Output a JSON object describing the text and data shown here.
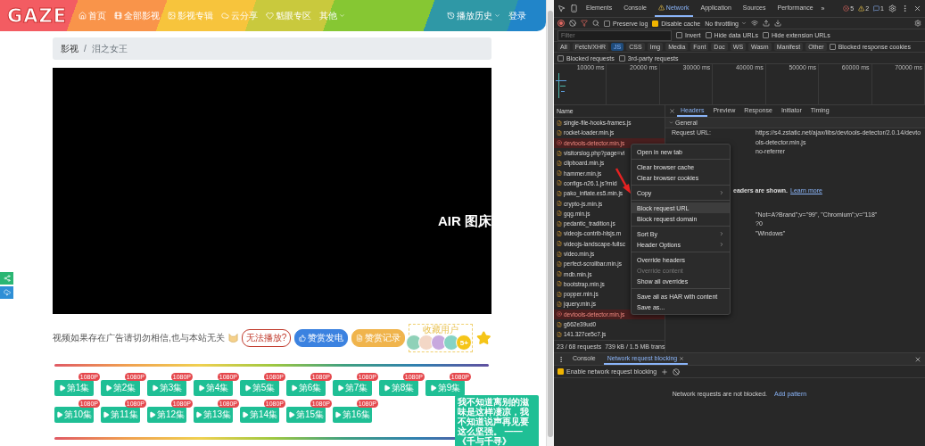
{
  "nav": {
    "logo": "GAZE",
    "items": [
      {
        "label": "首页",
        "dropdown": false
      },
      {
        "label": "全部影视",
        "dropdown": false
      },
      {
        "label": "影视专辑",
        "dropdown": false
      },
      {
        "label": "云分享",
        "dropdown": false
      },
      {
        "label": "魁眼专区",
        "dropdown": false
      },
      {
        "label": "其他",
        "dropdown": true
      }
    ],
    "history": {
      "label": "播放历史",
      "dropdown": true
    },
    "login": "登录"
  },
  "breadcrumb": {
    "items": [
      "影视",
      "泪之女王"
    ],
    "separator": "/"
  },
  "video": {
    "overlay_text": "AIR 图床"
  },
  "notice": "视频如果存在广告请切勿相信,也与本站无关",
  "actions": [
    {
      "label": "无法播放?",
      "kind": "outline"
    },
    {
      "label": "赞赏发电",
      "kind": "blue"
    },
    {
      "label": "赞赏记录",
      "kind": "yellow"
    }
  ],
  "collectors": {
    "title": "收藏用户",
    "avatars": [
      {
        "color": "#8fd1b8"
      },
      {
        "color": "#f3d7c6"
      },
      {
        "color": "#c8a8de"
      },
      {
        "color": "#86d3c4"
      }
    ],
    "more": "5+"
  },
  "episodes": [
    {
      "label": "第1集",
      "badge": "1080P"
    },
    {
      "label": "第2集",
      "badge": "1080P"
    },
    {
      "label": "第3集",
      "badge": "1080P"
    },
    {
      "label": "第4集",
      "badge": "1080P"
    },
    {
      "label": "第5集",
      "badge": "1080P"
    },
    {
      "label": "第6集",
      "badge": "1080P"
    },
    {
      "label": "第7集",
      "badge": "1080P"
    },
    {
      "label": "第8集",
      "badge": "1080P"
    },
    {
      "label": "第9集",
      "badge": "1080P"
    },
    {
      "label": "第10集",
      "badge": "1080P"
    },
    {
      "label": "第11集",
      "badge": "1080P"
    },
    {
      "label": "第12集",
      "badge": "1080P"
    },
    {
      "label": "第13集",
      "badge": "1080P"
    },
    {
      "label": "第14集",
      "badge": "1080P"
    },
    {
      "label": "第15集",
      "badge": "1080P"
    },
    {
      "label": "第16集",
      "badge": "1080P"
    }
  ],
  "quote": "我不知道离别的滋味是这样凄凉，我不知道说声再见要这么坚强。 ——《千与千寻》",
  "devtools": {
    "tabs": [
      {
        "label": "Elements",
        "selected": false,
        "warning": false
      },
      {
        "label": "Console",
        "selected": false,
        "warning": false
      },
      {
        "label": "Network",
        "selected": true,
        "warning": true
      },
      {
        "label": "Application",
        "selected": false,
        "warning": false
      },
      {
        "label": "Sources",
        "selected": false,
        "warning": false
      },
      {
        "label": "Performance",
        "selected": false,
        "warning": false
      }
    ],
    "more": "»",
    "errors": "5",
    "warnings": "2",
    "infos": "1",
    "preserve_log": {
      "label": "Preserve log",
      "checked": false
    },
    "disable_cache": {
      "label": "Disable cache",
      "checked": true
    },
    "throttling": "No throttling",
    "filter": {
      "placeholder": "Filter"
    },
    "filter_options": [
      {
        "label": "Invert",
        "checked": false
      },
      {
        "label": "Hide data URLs",
        "checked": false
      },
      {
        "label": "Hide extension URLs",
        "checked": false
      }
    ],
    "types": [
      {
        "label": "All",
        "selected": false
      },
      {
        "label": "Fetch/XHR",
        "selected": false
      },
      {
        "label": "JS",
        "selected": true
      },
      {
        "label": "CSS",
        "selected": false
      },
      {
        "label": "Img",
        "selected": false
      },
      {
        "label": "Media",
        "selected": false
      },
      {
        "label": "Font",
        "selected": false
      },
      {
        "label": "Doc",
        "selected": false
      },
      {
        "label": "WS",
        "selected": false
      },
      {
        "label": "Wasm",
        "selected": false
      },
      {
        "label": "Manifest",
        "selected": false
      },
      {
        "label": "Other",
        "selected": false
      }
    ],
    "blocked_cookies": {
      "label": "Blocked response cookies",
      "checked": false
    },
    "more_options": [
      {
        "label": "Blocked requests",
        "checked": false
      },
      {
        "label": "3rd-party requests",
        "checked": false
      }
    ],
    "ticks": [
      "10000 ms",
      "20000 ms",
      "30000 ms",
      "40000 ms",
      "50000 ms",
      "60000 ms",
      "70000 ms"
    ],
    "name_header": "Name",
    "requests": [
      {
        "name": "single-file-hooks-frames.js",
        "error": false
      },
      {
        "name": "rocket-loader.min.js",
        "error": false
      },
      {
        "name": "devtools-detector.min.js",
        "error": true
      },
      {
        "name": "visitorslog.php?page=vi",
        "error": false
      },
      {
        "name": "clipboard.min.js",
        "error": false
      },
      {
        "name": "hammer.min.js",
        "error": false
      },
      {
        "name": "configs-n26.1.js?mid",
        "error": false
      },
      {
        "name": "pako_inflate.es5.min.js",
        "error": false
      },
      {
        "name": "crypto-js.min.js",
        "error": false
      },
      {
        "name": "gqg.min.js",
        "error": false
      },
      {
        "name": "pedantic_tradition.js",
        "error": false
      },
      {
        "name": "videojs-contrib-hlsjs.m",
        "error": false
      },
      {
        "name": "videojs-landscape-fullsc",
        "error": false
      },
      {
        "name": "video.min.js",
        "error": false
      },
      {
        "name": "perfect-scrollbar.min.js",
        "error": false
      },
      {
        "name": "mdb.min.js",
        "error": false
      },
      {
        "name": "bootstrap.min.js",
        "error": false
      },
      {
        "name": "popper.min.js",
        "error": false
      },
      {
        "name": "jquery.min.js",
        "error": false
      },
      {
        "name": "devtools-detector.min.js",
        "error": true
      },
      {
        "name": "g662e39ud0",
        "error": false
      },
      {
        "name": "141.327ce5c7.js",
        "error": false
      }
    ],
    "status": {
      "requests": "23 / 68 requests",
      "transferred": "739 kB / 1.5 MB trans"
    },
    "detail_tabs": [
      {
        "label": "Headers",
        "selected": true
      },
      {
        "label": "Preview",
        "selected": false
      },
      {
        "label": "Response",
        "selected": false
      },
      {
        "label": "Initiator",
        "selected": false
      },
      {
        "label": "Timing",
        "selected": false
      }
    ],
    "general": {
      "title": "General",
      "request_url_label": "Request URL:",
      "request_url": "https://s4.zstatic.net/ajax/libs/devtools-detector/2.0.14/devtools-detector.min.js",
      "policy": "no-referrer"
    },
    "headers_note": "eaders are shown.",
    "learn_more": "Learn more",
    "header_values": [
      "\"Not=A?Brand\";v=\"99\", \"Chromium\";v=\"118\"",
      "?0",
      "\"Windows\""
    ],
    "context_menu": [
      [
        {
          "label": "Open in new tab",
          "submenu": false,
          "disabled": false,
          "selected": false
        }
      ],
      [
        {
          "label": "Clear browser cache",
          "submenu": false,
          "disabled": false,
          "selected": false
        },
        {
          "label": "Clear browser cookies",
          "submenu": false,
          "disabled": false,
          "selected": false
        }
      ],
      [
        {
          "label": "Copy",
          "submenu": true,
          "disabled": false,
          "selected": false
        }
      ],
      [
        {
          "label": "Block request URL",
          "submenu": false,
          "disabled": false,
          "selected": true
        },
        {
          "label": "Block request domain",
          "submenu": false,
          "disabled": false,
          "selected": false
        }
      ],
      [
        {
          "label": "Sort By",
          "submenu": true,
          "disabled": false,
          "selected": false
        },
        {
          "label": "Header Options",
          "submenu": true,
          "disabled": false,
          "selected": false
        }
      ],
      [
        {
          "label": "Override headers",
          "submenu": false,
          "disabled": false,
          "selected": false
        },
        {
          "label": "Override content",
          "submenu": false,
          "disabled": true,
          "selected": false
        },
        {
          "label": "Show all overrides",
          "submenu": false,
          "disabled": false,
          "selected": false
        }
      ],
      [
        {
          "label": "Save all as HAR with content",
          "submenu": false,
          "disabled": false,
          "selected": false
        },
        {
          "label": "Save as...",
          "submenu": false,
          "disabled": false,
          "selected": false
        }
      ]
    ],
    "drawer": {
      "tabs": [
        {
          "label": "Console",
          "selected": false
        },
        {
          "label": "Network request blocking",
          "selected": true
        }
      ],
      "enable": {
        "label": "Enable network request blocking",
        "checked": true
      },
      "empty": "Network requests are not blocked.",
      "add_pattern": "Add pattern"
    }
  }
}
